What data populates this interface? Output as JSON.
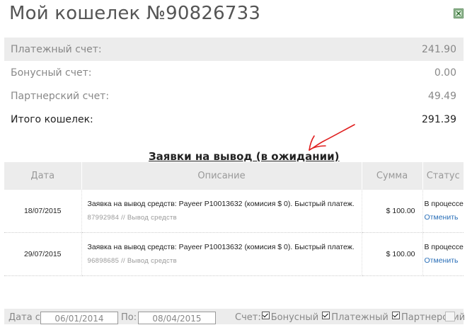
{
  "wallet": {
    "title": "Мой кошелек №90826733",
    "export_icon": "excel-export-icon"
  },
  "accounts": [
    {
      "label": "Платежный счет:",
      "value": "241.90"
    },
    {
      "label": "Бонусный счет:",
      "value": "0.00"
    },
    {
      "label": "Партнерский счет:",
      "value": "49.49"
    },
    {
      "label": "Итого кошелек:",
      "value": "291.39"
    }
  ],
  "withdrawals": {
    "title": "Заявки на вывод (в ожидании)",
    "columns": {
      "date": "Дата",
      "description": "Описание",
      "amount": "Сумма",
      "status": "Статус"
    },
    "rows": [
      {
        "date": "18/07/2015",
        "description": "Заявка на вывод средств: Payeer P10013632 (комисия $ 0). Быстрый платеж.",
        "meta": "87992984 // Вывод средств",
        "amount": "$ 100.00",
        "status": "В процессе",
        "cancel": "Отменить"
      },
      {
        "date": "29/07/2015",
        "description": "Заявка на вывод средств: Payeer P10013632 (комисия $ 0). Быстрый платеж.",
        "meta": "96898685 // Вывод средств",
        "amount": "$ 100.00",
        "status": "В процессе",
        "cancel": "Отменить"
      }
    ]
  },
  "filter": {
    "date_from_label": "Дата с:",
    "date_from": "06/01/2014",
    "date_to_label": "По:",
    "date_to": "08/04/2015",
    "accounts_label": "Счет:",
    "bonus": "Бонусный",
    "payment": "Платежный",
    "partner": "Партнерский"
  },
  "colors": {
    "annotation_arrow": "#e02020",
    "link": "#2a6fb8"
  }
}
